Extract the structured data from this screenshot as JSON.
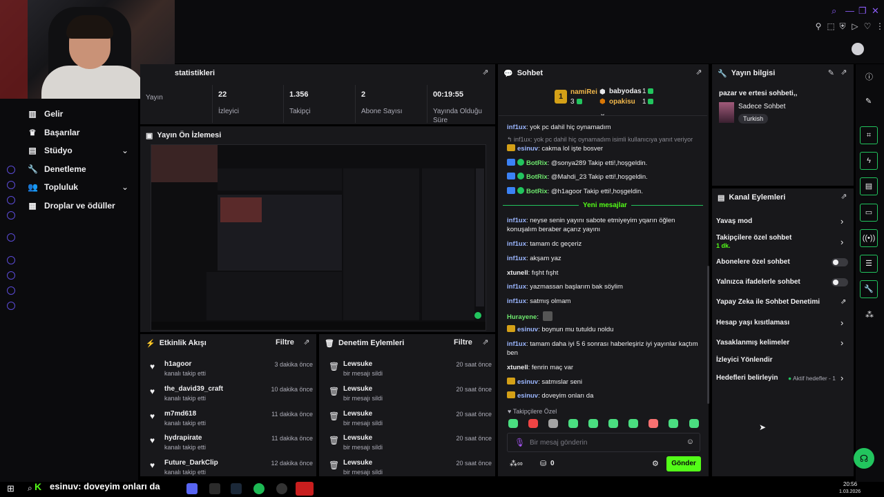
{
  "stats": {
    "title": "statistikleri",
    "items": [
      {
        "value": "",
        "label": "Yayın"
      },
      {
        "value": "22",
        "label": "İzleyici"
      },
      {
        "value": "1.356",
        "label": "Takipçi"
      },
      {
        "value": "2",
        "label": "Abone Sayısı"
      },
      {
        "value": "00:19:55",
        "label": "Yayında Olduğu Süre"
      }
    ]
  },
  "nav": {
    "items": [
      {
        "label": "Gelir",
        "icon": "chart-icon"
      },
      {
        "label": "Başarılar",
        "icon": "trophy-icon"
      },
      {
        "label": "Stüdyo",
        "icon": "studio-icon"
      },
      {
        "label": "Denetleme",
        "icon": "wrench-icon"
      },
      {
        "label": "Topluluk",
        "icon": "community-icon"
      },
      {
        "label": "Droplar ve ödüller",
        "icon": "gift-icon"
      }
    ]
  },
  "preview": {
    "title": "Yayın Ön İzlemesi"
  },
  "activity": {
    "title": "Etkinlik Akışı",
    "filter": "Filtre",
    "rows": [
      {
        "name": "h1agoor",
        "sub": "kanalı takip etti",
        "time": "3 dakika önce"
      },
      {
        "name": "the_david39_craft",
        "sub": "kanalı takip etti",
        "time": "10 dakika önce"
      },
      {
        "name": "m7md618",
        "sub": "kanalı takip etti",
        "time": "11 dakika önce"
      },
      {
        "name": "hydrapirate",
        "sub": "kanalı takip etti",
        "time": "11 dakika önce"
      },
      {
        "name": "Future_DarkClip",
        "sub": "kanalı takip etti",
        "time": "12 dakika önce"
      }
    ]
  },
  "moderation": {
    "title": "Denetim Eylemleri",
    "filter": "Filtre",
    "rows": [
      {
        "name": "Lewsuke",
        "sub": "bir mesajı sildi",
        "time": "20 saat önce"
      },
      {
        "name": "Lewsuke",
        "sub": "bir mesajı sildi",
        "time": "20 saat önce"
      },
      {
        "name": "Lewsuke",
        "sub": "bir mesajı sildi",
        "time": "20 saat önce"
      },
      {
        "name": "Lewsuke",
        "sub": "bir mesajı sildi",
        "time": "20 saat önce"
      },
      {
        "name": "Lewsuke",
        "sub": "bir mesajı sildi",
        "time": "20 saat önce"
      }
    ]
  },
  "chat": {
    "title": "Sohbet",
    "leaders": [
      {
        "rank": "1",
        "name": "namiRei",
        "count": "3"
      },
      {
        "name": "babyodas",
        "count": "1"
      },
      {
        "name": "opakisu",
        "count": "1"
      }
    ],
    "reply_ref": "inf1ux: yok pc dahil hiç oynamadım isimli kullanıcıya yanıt veriyor",
    "new_messages": "Yeni mesajlar",
    "messages": [
      {
        "user": "inf1ux",
        "text": "yok pc dahil hiç oynamadım"
      },
      {
        "user": "esinuv",
        "text": "cakma lol işte bosver"
      },
      {
        "user": "BotRix",
        "text": "@sonya289 Takip etti!,hoşgeldin."
      },
      {
        "user": "BotRix",
        "text": "@Mahdi_23 Takip etti!,hoşgeldin."
      },
      {
        "user": "BotRix",
        "text": "@h1agoor Takip etti!,hoşgeldin."
      },
      {
        "user": "inf1ux",
        "text": "neyse senin yayını sabote etmiyeyim yqarın öğlen konuşalım beraber açarız yayını"
      },
      {
        "user": "inf1ux",
        "text": "tamam dc geçeriz"
      },
      {
        "user": "inf1ux",
        "text": "akşam yaz"
      },
      {
        "user": "xtunell",
        "text": "fışht fışht"
      },
      {
        "user": "inf1ux",
        "text": "yazmassan başlarım bak söylim"
      },
      {
        "user": "inf1ux",
        "text": "satmış olmam"
      },
      {
        "user": "Hurayene",
        "text": ""
      },
      {
        "user": "esinuv",
        "text": "boynun mu tutuldu noldu"
      },
      {
        "user": "inf1ux",
        "text": "tamam daha iyi 5 6 sonrası haberleşiriz iyi yayınlar kaçtım ben"
      },
      {
        "user": "xtunell",
        "text": "fenrin maç var"
      },
      {
        "user": "esinuv",
        "text": "satmıslar seni"
      },
      {
        "user": "esinuv",
        "text": "doveyim onları da"
      }
    ],
    "followers_only": "Takipçilere Özel",
    "input_placeholder": "Bir mesaj gönderin",
    "points": "0",
    "send": "Gönder"
  },
  "stream_info": {
    "title": "Yayın bilgisi",
    "stream_title": "pazar ve ertesi sohbeti,,",
    "category": "Sadece Sohbet",
    "tag": "Turkish"
  },
  "channel_actions": {
    "title": "Kanal Eylemleri",
    "rows": [
      {
        "label": "Yavaş mod",
        "sub": ""
      },
      {
        "label": "Takipçilere özel sohbet",
        "sub": "1 dk."
      },
      {
        "label": "Abonelere özel sohbet",
        "sub": ""
      },
      {
        "label": "Yalnızca ifadelerle sohbet",
        "sub": ""
      },
      {
        "label": "Yapay Zeka ile Sohbet Denetimi",
        "sub": ""
      },
      {
        "label": "Hesap yaşı kısıtlaması",
        "sub": ""
      },
      {
        "label": "Yasaklanmış kelimeler",
        "sub": ""
      },
      {
        "label": "İzleyici Yönlendir",
        "sub": ""
      },
      {
        "label": "Hedefleri belirleyin",
        "sub": ""
      }
    ],
    "goals_status": "Aktif hedefler - 1"
  },
  "taskbar": {
    "caption": "esinuv: doveyim onları da",
    "time": "20:56",
    "date": "1.03.2026"
  },
  "colors": {
    "accent": "#53fc18",
    "panel": "#18181b",
    "purple": "#8b5cf6"
  }
}
